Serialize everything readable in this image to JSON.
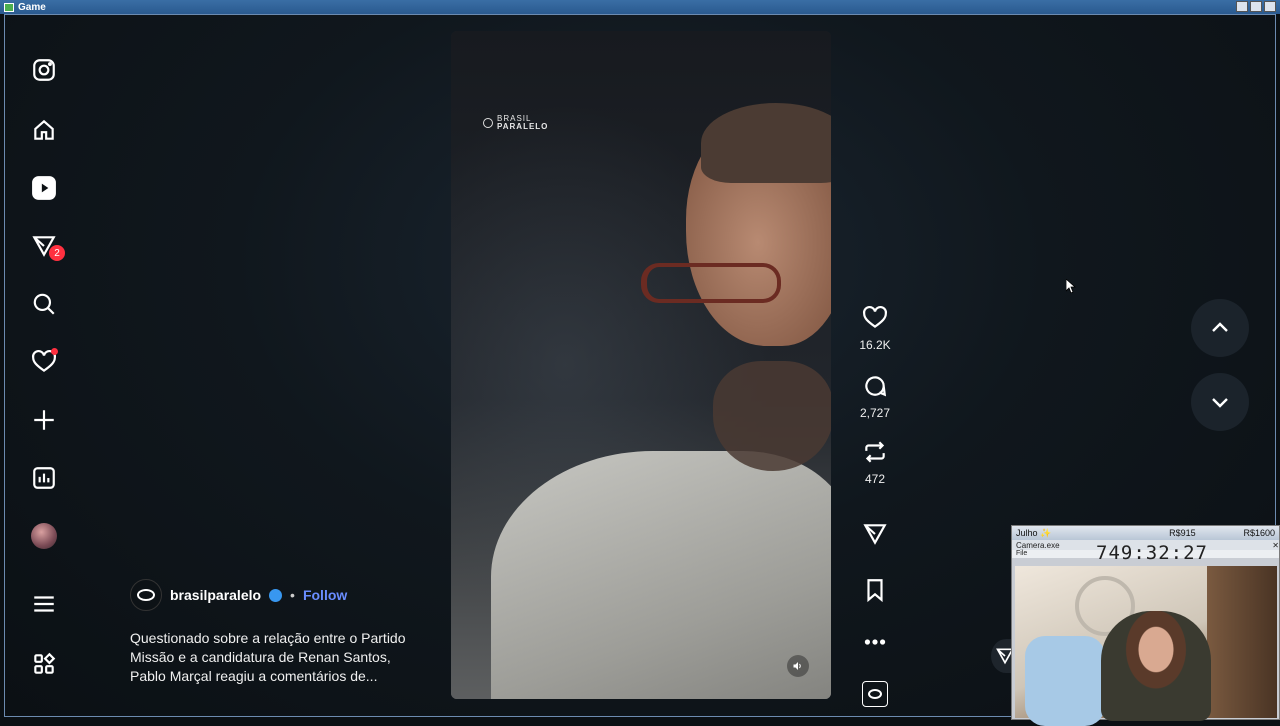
{
  "window": {
    "title": "Game"
  },
  "sidebar": {
    "items": [
      {
        "name": "instagram-logo-icon"
      },
      {
        "name": "home-icon"
      },
      {
        "name": "reels-icon"
      },
      {
        "name": "messages-icon",
        "badge": "2"
      },
      {
        "name": "search-icon"
      },
      {
        "name": "notifications-icon"
      },
      {
        "name": "create-icon"
      },
      {
        "name": "dashboard-icon"
      },
      {
        "name": "profile-avatar"
      },
      {
        "name": "more-menu-icon"
      },
      {
        "name": "apps-icon"
      }
    ]
  },
  "video": {
    "watermark_line1": "BRASIL",
    "watermark_line2": "PARALELO"
  },
  "actions": {
    "likes": "16.2K",
    "comments": "2,727",
    "reposts": "472"
  },
  "post": {
    "username": "brasilparalelo",
    "separator": "•",
    "follow_label": "Follow",
    "caption": "Questionado sobre a relação entre o Partido Missão e a candidatura de Renan Santos, Pablo Marçal reagiu a comentários de..."
  },
  "overlay": {
    "left_label": "Julho ✨",
    "mid_label": "R$915",
    "right_label": "R$1600",
    "camera_title": "Camera.exe",
    "menu_label": "File",
    "timer": "749:32:27"
  },
  "colors": {
    "accent": "#6a8dff",
    "badge": "#ff3040",
    "background": "#0b1014"
  }
}
